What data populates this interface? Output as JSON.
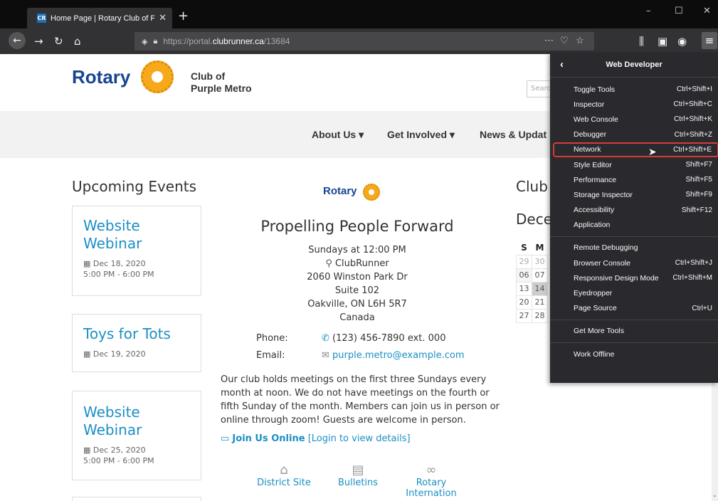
{
  "browser": {
    "tab_title": "Home Page | Rotary Club of Pu",
    "tab_favicon": "CR",
    "new_tab": "+",
    "url_prefix": "https://portal.",
    "url_domain": "clubrunner.ca",
    "url_path": "/13684",
    "win_min": "–",
    "win_max": "☐",
    "win_close": "✕"
  },
  "header": {
    "logo_text": "Rotary",
    "club_line1": "Club of",
    "club_line2": "Purple Metro",
    "search_placeholder": "Search"
  },
  "nav": {
    "items": [
      "About Us ▾",
      "Get Involved ▾",
      "News & Updat"
    ]
  },
  "events": {
    "heading": "Upcoming Events",
    "items": [
      {
        "title": "Website Webinar",
        "date": "Dec 18, 2020",
        "time": "5:00 PM - 6:00 PM"
      },
      {
        "title": "Toys for Tots",
        "date": "Dec 19, 2020",
        "time": ""
      },
      {
        "title": "Website Webinar",
        "date": "Dec 25, 2020",
        "time": "5:00 PM - 6:00 PM"
      }
    ]
  },
  "center": {
    "logo_text": "Rotary",
    "tagline": "Propelling People Forward",
    "meeting_time": "Sundays at 12:00 PM",
    "venue": "ClubRunner",
    "address1": "2060 Winston Park Dr",
    "address2": "Suite 102",
    "address3": "Oakville, ON L6H 5R7",
    "country": "Canada",
    "phone_label": "Phone:",
    "phone_value": "(123) 456-7890  ext. 000",
    "email_label": "Email:",
    "email_value": "purple.metro@example.com",
    "paragraph": "Our club holds meetings on the first three Sundays every month at noon. We do not have meetings on the fourth or fifth Sunday of the month. Members can join us in person or online through zoom! Guests are welcome in person.",
    "join_label": "Join Us Online",
    "join_login": "[Login to view details]",
    "quick_links": [
      "District Site",
      "Bulletins",
      "Rotary Internation"
    ]
  },
  "calendar": {
    "heading1": "Club",
    "heading2": "Dece",
    "headers": [
      "S",
      "M"
    ],
    "rows": [
      [
        "29",
        "30"
      ],
      [
        "06",
        "07"
      ],
      [
        "13",
        "14"
      ],
      [
        "20",
        "21"
      ],
      [
        "27",
        "28"
      ]
    ]
  },
  "devmenu": {
    "title": "Web Developer",
    "groups": [
      [
        {
          "label": "Toggle Tools",
          "key": "Ctrl+Shift+I"
        },
        {
          "label": "Inspector",
          "key": "Ctrl+Shift+C"
        },
        {
          "label": "Web Console",
          "key": "Ctrl+Shift+K"
        },
        {
          "label": "Debugger",
          "key": "Ctrl+Shift+Z"
        },
        {
          "label": "Network",
          "key": "Ctrl+Shift+E"
        },
        {
          "label": "Style Editor",
          "key": "Shift+F7"
        },
        {
          "label": "Performance",
          "key": "Shift+F5"
        },
        {
          "label": "Storage Inspector",
          "key": "Shift+F9"
        },
        {
          "label": "Accessibility",
          "key": "Shift+F12"
        },
        {
          "label": "Application",
          "key": ""
        }
      ],
      [
        {
          "label": "Remote Debugging",
          "key": ""
        },
        {
          "label": "Browser Console",
          "key": "Ctrl+Shift+J"
        },
        {
          "label": "Responsive Design Mode",
          "key": "Ctrl+Shift+M"
        },
        {
          "label": "Eyedropper",
          "key": ""
        },
        {
          "label": "Page Source",
          "key": "Ctrl+U"
        }
      ],
      [
        {
          "label": "Get More Tools",
          "key": ""
        }
      ],
      [
        {
          "label": "Work Offline",
          "key": ""
        }
      ]
    ],
    "selected": "Network"
  },
  "colors": {
    "rotary_blue": "#17458f",
    "rotary_gold": "#f7a81b",
    "link_blue": "#1b8fc4",
    "highlight_red": "#d83a3a"
  }
}
